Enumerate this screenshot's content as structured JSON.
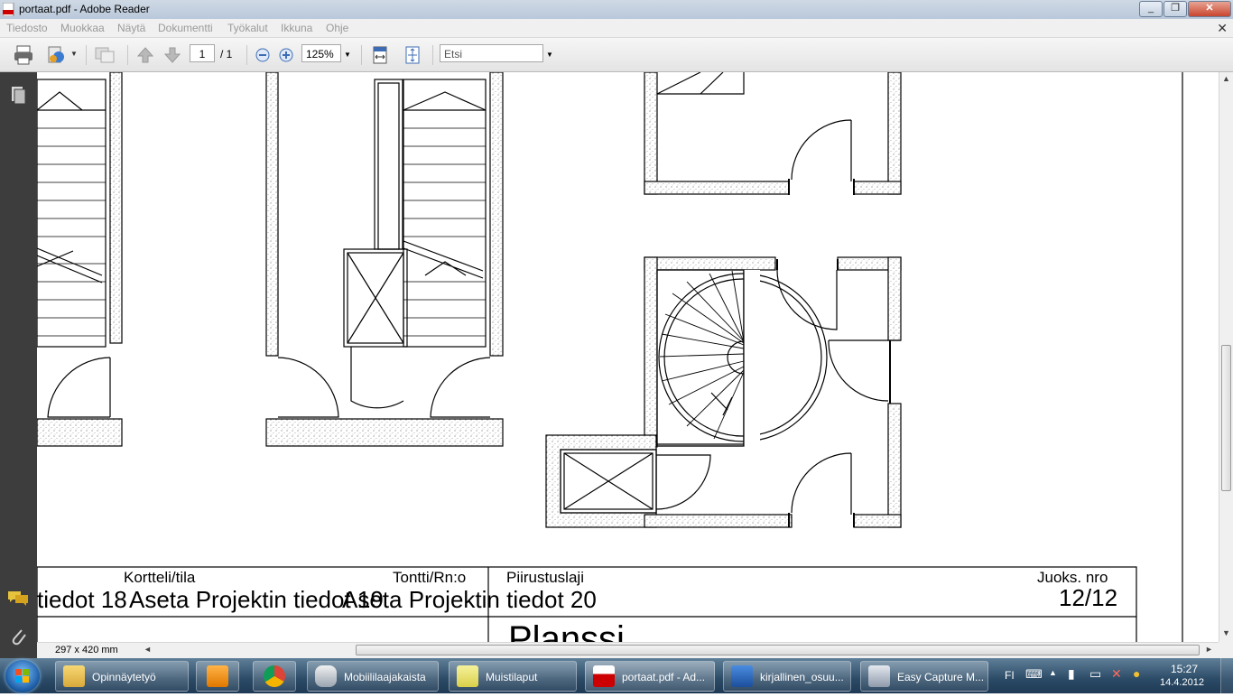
{
  "window": {
    "title": "portaat.pdf - Adobe Reader"
  },
  "menu": {
    "items": [
      "Tiedosto",
      "Muokkaa",
      "Näytä",
      "Dokumentti",
      "Työkalut",
      "Ikkuna",
      "Ohje"
    ]
  },
  "toolbar": {
    "page_current": "1",
    "page_total": "/ 1",
    "zoom": "125%",
    "search_placeholder": "Etsi"
  },
  "document": {
    "title_block": {
      "kortteli_label": "Kortteli/tila",
      "tontti_label": "Tontti/Rn:o",
      "piirustuslaji_label": "Piirustuslaji",
      "juoks_label": "Juoks. nro",
      "left_value_a": "tiedot 18",
      "left_value_b": "Aseta Projektin tiedot 19",
      "middle_value": "Aseta Projektin tiedot 20",
      "sheet_number": "12/12",
      "plan_title": "Planssi"
    },
    "page_size": "297 x 420 mm"
  },
  "taskbar": {
    "items": [
      {
        "label": "Opinnäytetyö"
      },
      {
        "label": ""
      },
      {
        "label": ""
      },
      {
        "label": "Mobiililaajakaista"
      },
      {
        "label": "Muistilaput"
      },
      {
        "label": "portaat.pdf - Ad..."
      },
      {
        "label": "kirjallinen_osuu..."
      },
      {
        "label": "Easy Capture M..."
      }
    ],
    "tray": {
      "lang": "FI",
      "time": "15:27",
      "date": "14.4.2012"
    }
  },
  "colors": {
    "accent": "#2b4a66",
    "panel": "#3d3d3d"
  }
}
